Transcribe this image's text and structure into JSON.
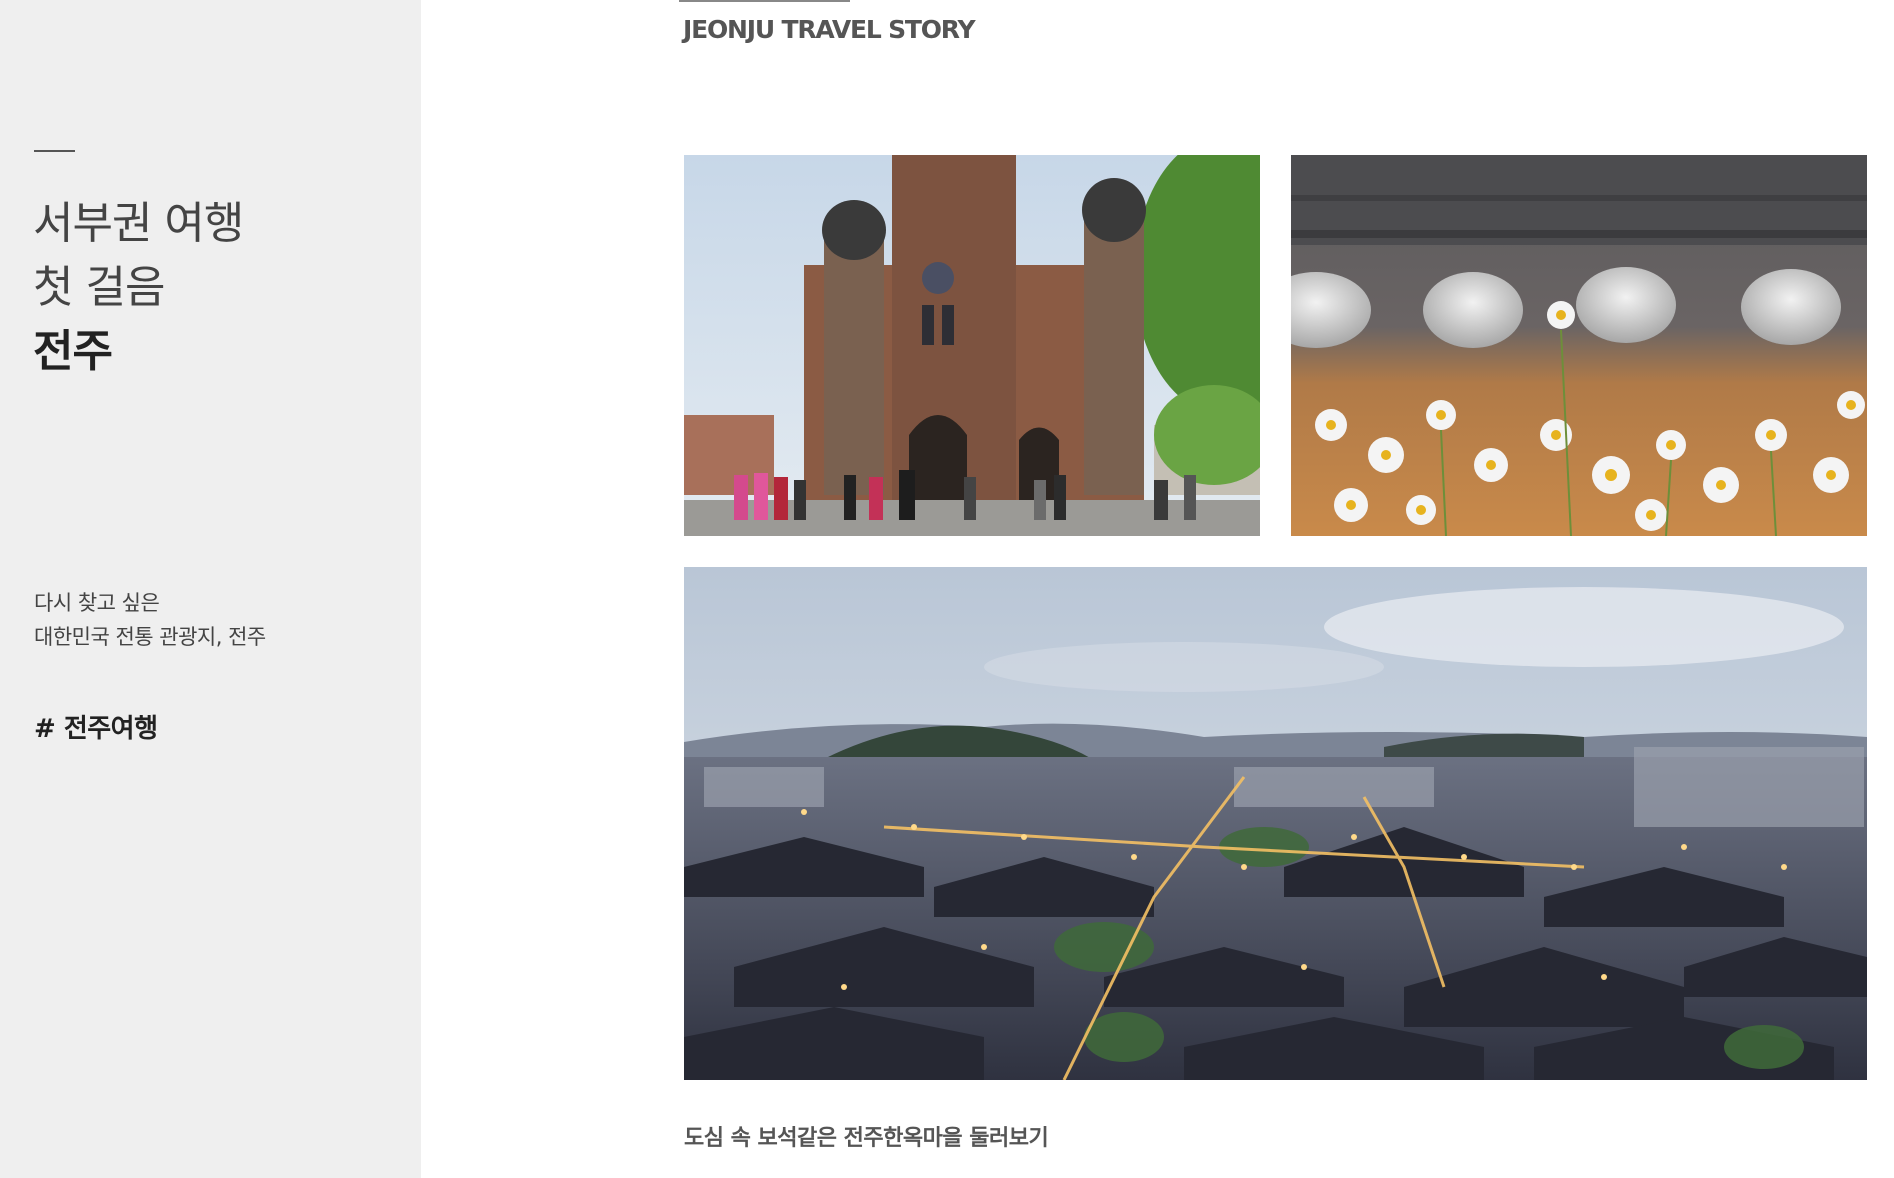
{
  "sidebar": {
    "title_line1": "서부권 여행",
    "title_line2": "첫 걸음",
    "title_strong": "전주",
    "desc_line1": "다시 찾고 싶은",
    "desc_line2": "대한민국 전통 관광지, 전주",
    "hashtag": "# 전주여행"
  },
  "main": {
    "section_label": "JEONJU TRAVEL STORY",
    "caption": "도심 속 보석같은 전주한옥마을 둘러보기"
  },
  "photos": [
    {
      "name": "cathedral-photo"
    },
    {
      "name": "daisy-roof-photo"
    },
    {
      "name": "hanok-village-night-photo"
    }
  ]
}
